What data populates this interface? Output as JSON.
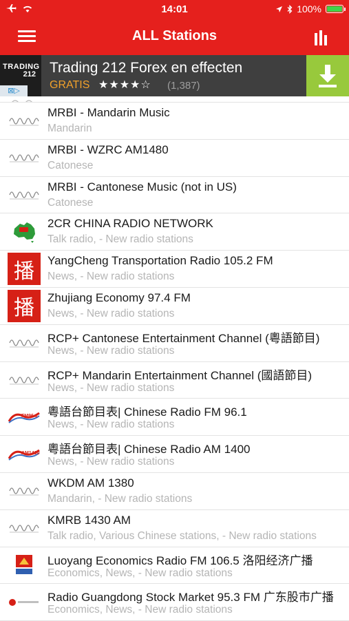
{
  "status_bar": {
    "time": "14:01",
    "battery": "100%",
    "battery_level": 1.0
  },
  "header": {
    "title": "ALL Stations"
  },
  "icons": {
    "menu": "hamburger-menu-icon",
    "bars": "equalizer-bars-icon",
    "download": "download-arrow-icon",
    "airplane": "airplane-icon",
    "wifi": "wifi-icon",
    "location": "location-arrow-icon",
    "bluetooth": "bluetooth-icon"
  },
  "ad": {
    "logo_line1": "TRADING",
    "logo_line2": "212",
    "adchoices": "⊠▷",
    "title": "Trading 212 Forex en effecten",
    "price": "GRATIS",
    "rating": "★★★★☆",
    "reviews": "(1,387)"
  },
  "colors": {
    "accent": "#e5201d",
    "ad_bg": "#3f3f3f",
    "download_bg": "#98c93c",
    "gratis": "#f2a12a"
  },
  "stations": [
    {
      "name": "MRBI - Mandarin Music",
      "genre": "Mandarin",
      "logo": "wave"
    },
    {
      "name": "MRBI - WZRC AM1480",
      "genre": "Catonese",
      "logo": "wave"
    },
    {
      "name": "MRBI - Cantonese Music (not in US)",
      "genre": "Catonese",
      "logo": "wave"
    },
    {
      "name": "2CR CHINA RADIO NETWORK",
      "genre": "Talk radio, - New radio stations",
      "logo": "australia"
    },
    {
      "name": "YangCheng Transportation Radio 105.2 FM",
      "genre": "News, - New radio stations",
      "logo": "bo",
      "logo_char": "播"
    },
    {
      "name": "Zhujiang Economy 97.4 FM",
      "genre": "News, - New radio stations",
      "logo": "bo",
      "logo_char": "播"
    },
    {
      "name": "RCP+ Cantonese Entertainment Channel (粵語節目)",
      "genre": "News, - New radio stations",
      "logo": "wave"
    },
    {
      "name": "RCP+ Mandarin Entertainment Channel (國語節目)",
      "genre": "News, - New radio stations",
      "logo": "wave"
    },
    {
      "name": "粵語台節目表| Chinese Radio FM 96.1",
      "genre": "News, - New radio stations",
      "logo": "fm",
      "logo_text": "FM96.1"
    },
    {
      "name": "粵語台節目表| Chinese Radio AM 1400",
      "genre": "News, - New radio stations",
      "logo": "fm",
      "logo_text": "AM1400"
    },
    {
      "name": "WKDM AM 1380",
      "genre": "Mandarin, - New radio stations",
      "logo": "wave"
    },
    {
      "name": "KMRB 1430 AM",
      "genre": "Talk radio, Various Chinese stations, - New radio stations",
      "logo": "wave"
    },
    {
      "name": "Luoyang Economics Radio FM 106.5 洛阳经济广播",
      "genre": "Economics, News, - New radio stations",
      "logo": "luoyang"
    },
    {
      "name": "Radio Guangdong Stock Market 95.3 FM 广东股市广播",
      "genre": "Economics, News, - New radio stations",
      "logo": "guangdong"
    }
  ]
}
